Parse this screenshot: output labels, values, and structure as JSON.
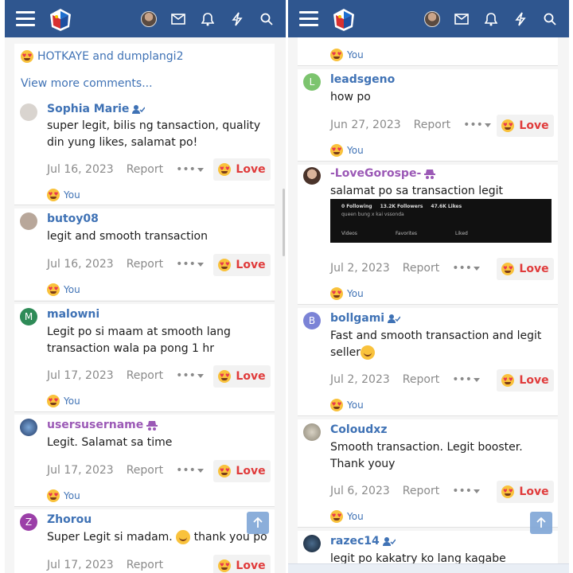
{
  "left": {
    "top_reactions": "HOTKAYE and dumplangi2",
    "view_more": "View more comments...",
    "comments": [
      {
        "user": "Sophia Marie",
        "avatar": "photo",
        "verified": true,
        "msg": "super legit, bilis ng tansaction, quality din yung likes, salamat po!",
        "date": "Jul 16, 2023",
        "report": "Report",
        "love": "Love",
        "you": "You"
      },
      {
        "user": "butoy08",
        "avatar": "photo",
        "verified": false,
        "msg": "legit and smooth transaction",
        "date": "Jul 16, 2023",
        "report": "Report",
        "love": "Love",
        "you": "You"
      },
      {
        "user": "malowni",
        "avatar": "M",
        "verified": false,
        "msg": "Legit po si maam at smooth lang transaction wala pa pong 1 hr",
        "date": "Jul 17, 2023",
        "report": "Report",
        "love": "Love",
        "you": "You"
      },
      {
        "user": "usersusername",
        "avatar": "photo",
        "verified": false,
        "msg": "Legit. Salamat sa time",
        "date": "Jul 17, 2023",
        "report": "Report",
        "love": "Love",
        "you": "You"
      },
      {
        "user": "Zhorou",
        "avatar": "Z",
        "verified": false,
        "msg": "Super Legit si madam.",
        "msg2": "thank you po",
        "date": "Jul 17, 2023",
        "report": "Report",
        "love": "Love"
      }
    ]
  },
  "right": {
    "top_you": "You",
    "comments": [
      {
        "user": "leadsgeno",
        "avatar": "L",
        "msg": "how po",
        "date": "Jun 27, 2023",
        "report": "Report",
        "love": "Love",
        "you": "You"
      },
      {
        "user": "-LoveGorospe-",
        "avatar": "photo",
        "msg": "salamat po sa transaction legit",
        "date": "Jul 2, 2023",
        "report": "Report",
        "love": "Love",
        "you": "You"
      },
      {
        "user": "bollgami",
        "avatar": "B",
        "msg": "Fast and smooth transaction and legit seller",
        "date": "Jul 2, 2023",
        "report": "Report",
        "love": "Love",
        "you": "You"
      },
      {
        "user": "Coloudxz",
        "avatar": "photo",
        "msg": "Smooth transaction. Legit booster. Thank youy",
        "date": "Jul 6, 2023",
        "report": "Report",
        "love": "Love",
        "you": "You"
      },
      {
        "user": "razec14",
        "avatar": "photo",
        "msg": "legit po kakatry ko lang kagabe"
      }
    ],
    "thumb": {
      "following_n": "0",
      "following": "Following",
      "followers_n": "13.2K",
      "followers": "Followers",
      "likes_n": "47.6K",
      "likes": "Likes",
      "bio": "queen bung x kai vssonda",
      "tabs": [
        "Videos",
        "Favorites",
        "Liked"
      ]
    }
  },
  "colors": {
    "topbar": "#2f568f",
    "link": "#3f72b5",
    "purple": "#9b59b6",
    "love": "#e03b3b"
  }
}
